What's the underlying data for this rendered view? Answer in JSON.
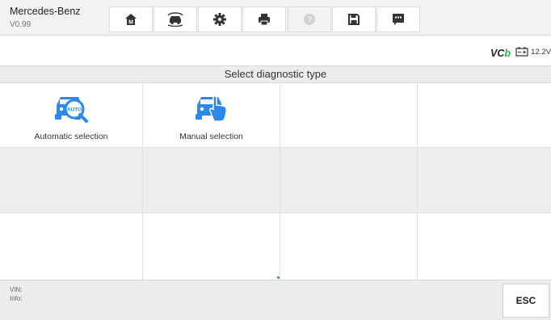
{
  "header": {
    "brand": "Mercedes-Benz",
    "version": "V0.99",
    "buttons": [
      {
        "name": "home",
        "icon": "home-icon",
        "enabled": true
      },
      {
        "name": "vehicle-swap",
        "icon": "car-swap-icon",
        "enabled": true
      },
      {
        "name": "settings",
        "icon": "gear-icon",
        "enabled": true
      },
      {
        "name": "print",
        "icon": "printer-icon",
        "enabled": true
      },
      {
        "name": "help",
        "icon": "help-icon",
        "enabled": false
      },
      {
        "name": "save",
        "icon": "save-icon",
        "enabled": true
      },
      {
        "name": "data-logging",
        "icon": "message-icon",
        "enabled": true
      }
    ]
  },
  "status": {
    "vci_prefix": "VC",
    "vci_suffix": "b",
    "battery_voltage": "12.2V",
    "vci_color": "#2db34a"
  },
  "page_title": "Select diagnostic type",
  "tiles": [
    {
      "label": "Automatic selection",
      "icon": "auto-search-car-icon",
      "badge": "AUTO"
    },
    {
      "label": "Manual selection",
      "icon": "manual-touch-car-icon"
    }
  ],
  "footer": {
    "vin_label": "VIN:",
    "info_label": "Info:",
    "esc_label": "ESC"
  },
  "colors": {
    "accent": "#2a7fe6",
    "icon_blue": "#2e88e8"
  }
}
